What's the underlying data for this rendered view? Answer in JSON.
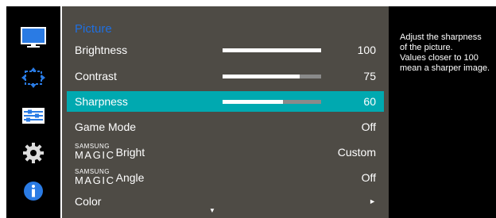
{
  "menu": {
    "title": "Picture",
    "items": [
      {
        "label": "Brightness",
        "value": "100",
        "level": 1.0
      },
      {
        "label": "Contrast",
        "value": "75",
        "level": 0.78
      },
      {
        "label": "Sharpness",
        "value": "60",
        "level": 0.61
      },
      {
        "label": "Game Mode",
        "value": "Off"
      },
      {
        "label": "Bright",
        "prefix_top": "SAMSUNG",
        "prefix_main": "MAGIC",
        "value": "Custom"
      },
      {
        "label": "Angle",
        "prefix_top": "SAMSUNG",
        "prefix_main": "MAGIC",
        "value": "Off"
      },
      {
        "label": "Color",
        "value": "►"
      }
    ],
    "selected_index": 2,
    "scroll_indicator": "▼"
  },
  "side_icons": [
    "monitor-icon",
    "resize-arrows-icon",
    "menu-settings-icon",
    "gear-icon",
    "info-icon"
  ],
  "help": {
    "text": "Adjust the sharpness\nof the picture.\nValues closer to 100\nmean a sharper image."
  },
  "colors": {
    "panel_bg": "#4e4b45",
    "selected": "#00a9b0",
    "title": "#1f6fe0",
    "icon_blue": "#2a7be4",
    "sidebar_bg": "#000000"
  }
}
